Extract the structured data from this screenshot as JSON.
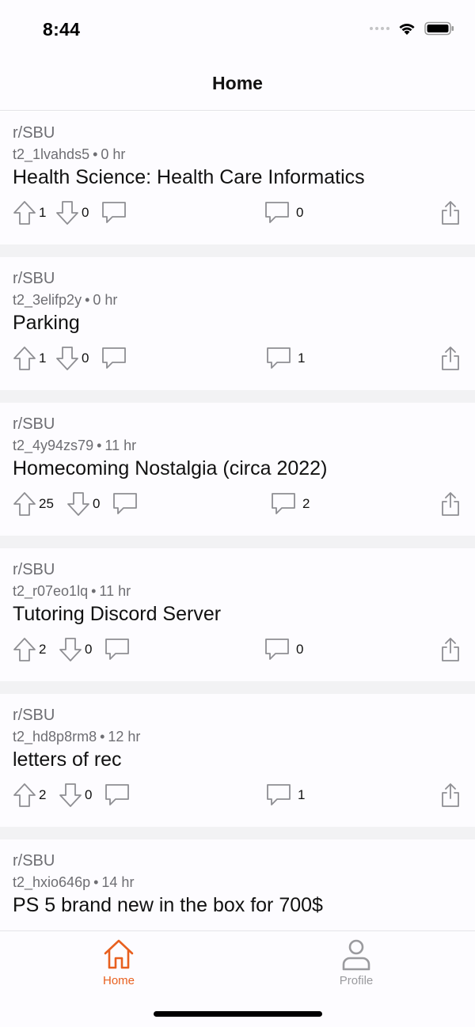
{
  "status_bar": {
    "time": "8:44"
  },
  "nav": {
    "title": "Home"
  },
  "posts": [
    {
      "subreddit": "r/SBU",
      "author": "t2_1lvahds5",
      "age": "0 hr",
      "title": "Health Science: Health Care Informatics",
      "upvotes": "1",
      "downvotes": "0",
      "comments": "0"
    },
    {
      "subreddit": "r/SBU",
      "author": "t2_3elifp2y",
      "age": "0 hr",
      "title": "Parking",
      "upvotes": "1",
      "downvotes": "0",
      "comments": "1"
    },
    {
      "subreddit": "r/SBU",
      "author": "t2_4y94zs79",
      "age": "11 hr",
      "title": "Homecoming Nostalgia (circa 2022)",
      "upvotes": "25",
      "downvotes": "0",
      "comments": "2"
    },
    {
      "subreddit": "r/SBU",
      "author": "t2_r07eo1lq",
      "age": "11 hr",
      "title": "Tutoring Discord Server",
      "upvotes": "2",
      "downvotes": "0",
      "comments": "0"
    },
    {
      "subreddit": "r/SBU",
      "author": "t2_hd8p8rm8",
      "age": "12 hr",
      "title": "letters of rec",
      "upvotes": "2",
      "downvotes": "0",
      "comments": "1"
    },
    {
      "subreddit": "r/SBU",
      "author": "t2_hxio646p",
      "age": "14 hr",
      "title": "PS 5 brand new in the box for 700$",
      "upvotes": "",
      "downvotes": "",
      "comments": ""
    }
  ],
  "meta_separator": "•",
  "tabs": [
    {
      "label": "Home",
      "icon": "house-icon",
      "active": true
    },
    {
      "label": "Profile",
      "icon": "person-icon",
      "active": false
    }
  ],
  "colors": {
    "accent": "#e8601f",
    "inactive_tab": "#9a9a9e",
    "secondary_text": "#6e6e73",
    "feed_separator": "#f2f2f4"
  }
}
